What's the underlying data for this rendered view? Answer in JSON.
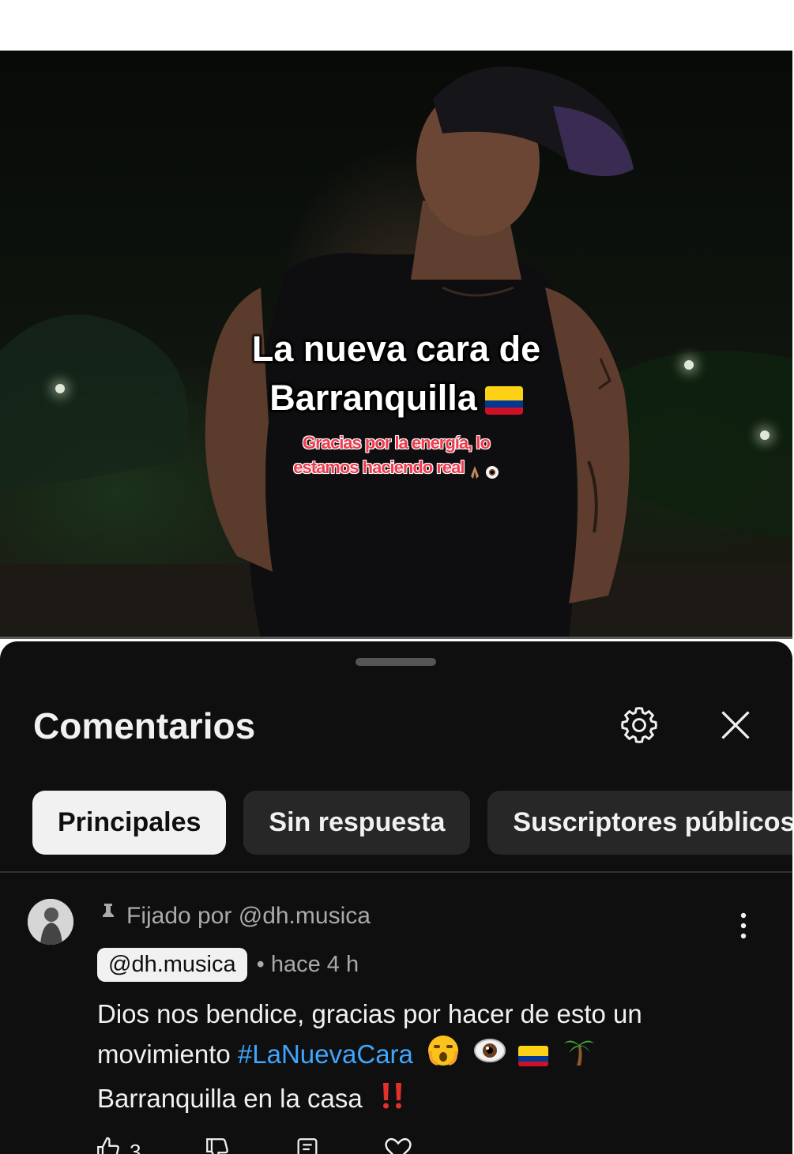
{
  "video": {
    "title_line1": "La nueva cara de",
    "title_line2": "Barranquilla",
    "subtitle_line1": "Gracias por la energía, lo",
    "subtitle_line2": "estamos haciendo real"
  },
  "comments_panel": {
    "title": "Comentarios",
    "filters": [
      {
        "label": "Principales",
        "active": true
      },
      {
        "label": "Sin respuesta",
        "active": false
      },
      {
        "label": "Suscriptores públicos",
        "active": false
      }
    ]
  },
  "pinned_comment": {
    "pinned_label": "Fijado por @dh.musica",
    "author": "@dh.musica",
    "time": "• hace 4 h",
    "text_line1": "Dios nos bendice, gracias por hacer de esto un",
    "text_line2_prefix": "movimiento",
    "hashtag": "#LaNuevaCara",
    "text_line3": "Barranquilla en la casa",
    "like_count": "3"
  },
  "colors": {
    "sheet_bg": "#0f0f0f",
    "chip_bg": "#272727",
    "chip_active_bg": "#f1f1f1",
    "hashtag": "#3ea6ff",
    "subtitle_red": "#ee3b4d"
  },
  "icons": [
    "settings-gear-icon",
    "close-icon",
    "pin-icon",
    "more-vert-icon",
    "thumb-up-icon",
    "thumb-down-icon",
    "reply-icon",
    "heart-icon"
  ]
}
